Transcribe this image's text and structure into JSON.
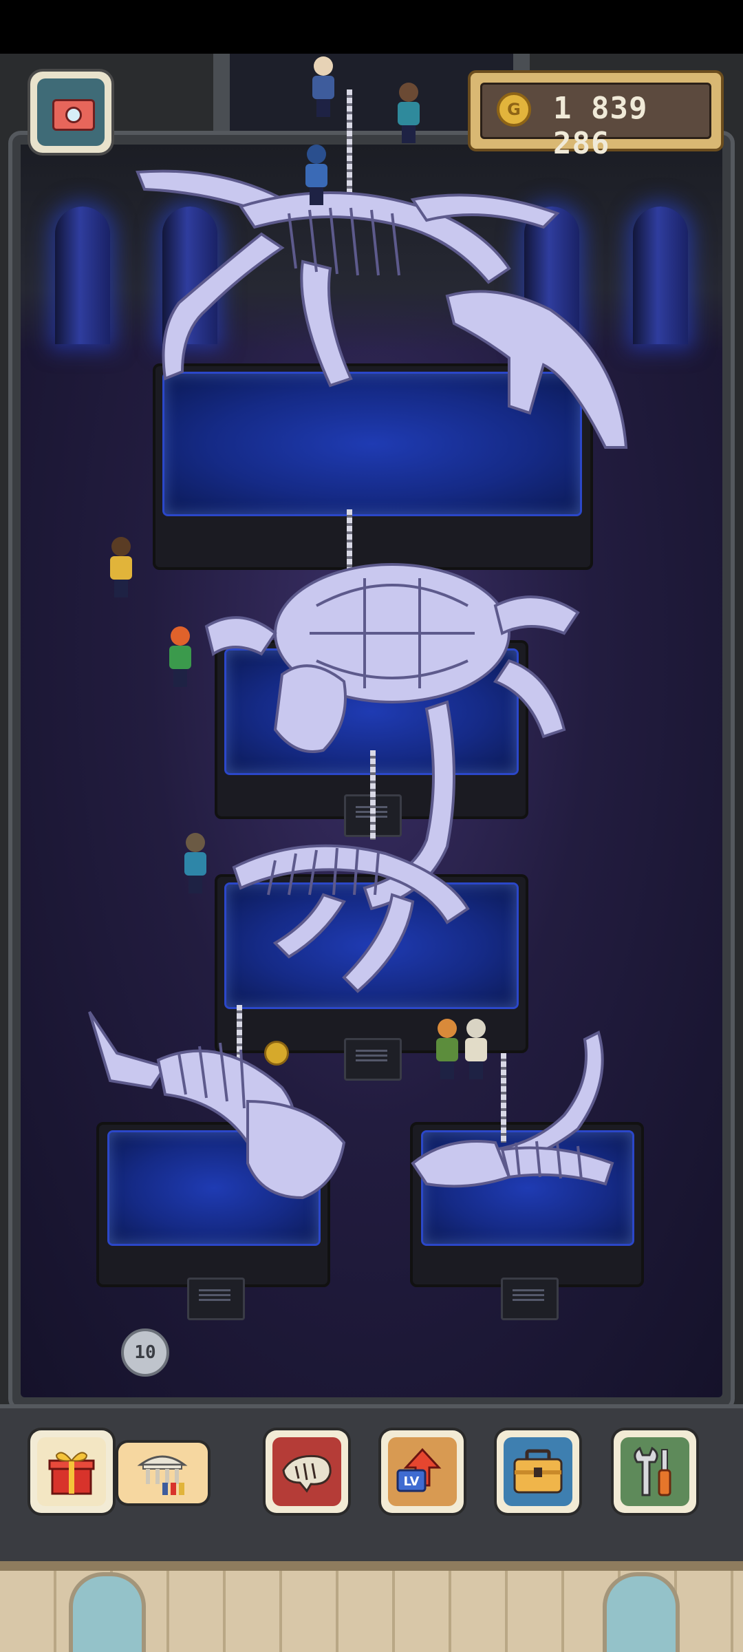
{
  "hud": {
    "money": "1 839 286",
    "coin_symbol": "G",
    "camera_icon": "camera-icon"
  },
  "floor": {
    "plaque_counter": "10"
  },
  "toolbar": {
    "buttons": [
      {
        "name": "gift",
        "icon": "gift-icon"
      },
      {
        "name": "museum-visitors",
        "icon": "museum-visitors-icon"
      },
      {
        "name": "fossil-collection",
        "icon": "fossil-icon"
      },
      {
        "name": "level-up",
        "icon": "level-up-icon"
      },
      {
        "name": "toolbox",
        "icon": "toolbox-icon"
      },
      {
        "name": "settings-tools",
        "icon": "wrench-screwdriver-icon"
      }
    ],
    "level_up_badge": "LV"
  },
  "colors": {
    "glass": "#1f3bb3",
    "bone": "#c9c8ef",
    "pillar_glow": "#2f3d9e",
    "money_panel": "#d9b873"
  }
}
